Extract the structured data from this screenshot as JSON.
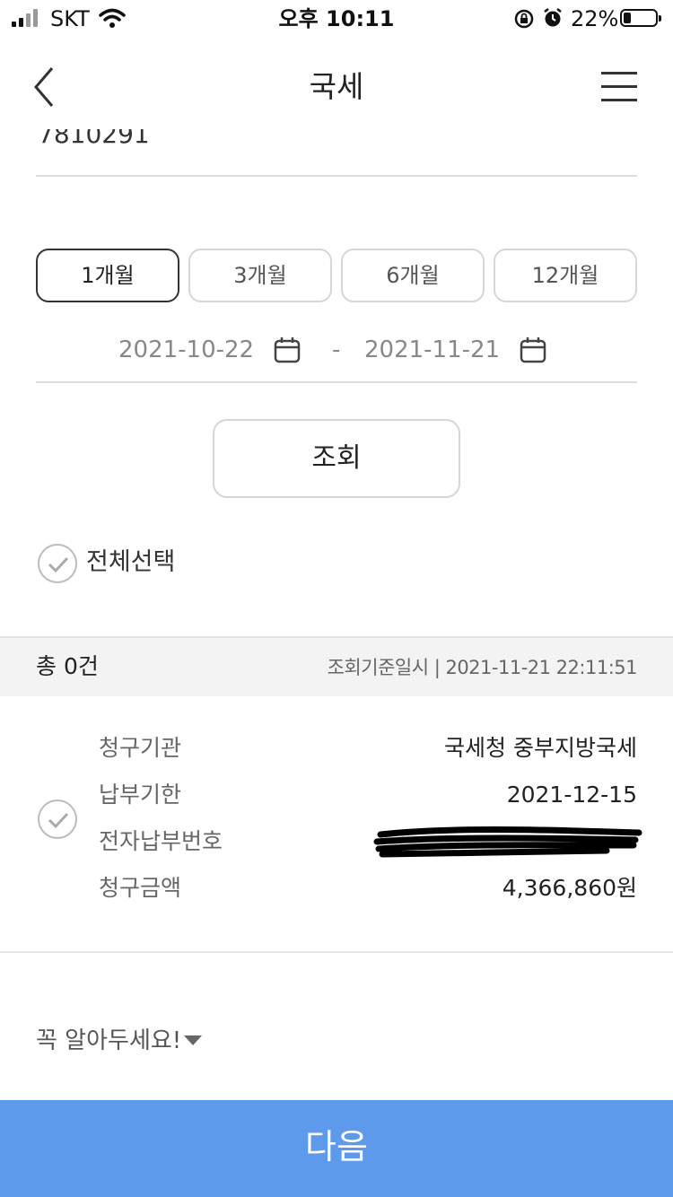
{
  "status_bar": {
    "carrier": "SKT",
    "time": "오후 10:11",
    "battery_percent": "22%",
    "battery_level": 0.22
  },
  "nav": {
    "title": "국세"
  },
  "account_partial": "7810291",
  "periods": [
    {
      "label": "1개월",
      "active": true
    },
    {
      "label": "3개월",
      "active": false
    },
    {
      "label": "6개월",
      "active": false
    },
    {
      "label": "12개월",
      "active": false
    }
  ],
  "date_range": {
    "start": "2021-10-22",
    "separator": "-",
    "end": "2021-11-21"
  },
  "query_button": "조회",
  "select_all": "전체선택",
  "summary": {
    "count": "총 0건",
    "stamp": "조회기준일시 | 2021-11-21 22:11:51"
  },
  "record": {
    "rows": [
      {
        "label": "청구기관",
        "value": "국세청 중부지방국세"
      },
      {
        "label": "납부기한",
        "value": "2021-12-15"
      },
      {
        "label": "전자납부번호",
        "value": ""
      },
      {
        "label": "청구금액",
        "value": "4,366,860원"
      }
    ]
  },
  "notice": "꼭 알아두세요!",
  "next_button": "다음",
  "colors": {
    "primary": "#5e9aec",
    "divider": "#dddddd",
    "summary_bg": "#f3f3f3"
  }
}
